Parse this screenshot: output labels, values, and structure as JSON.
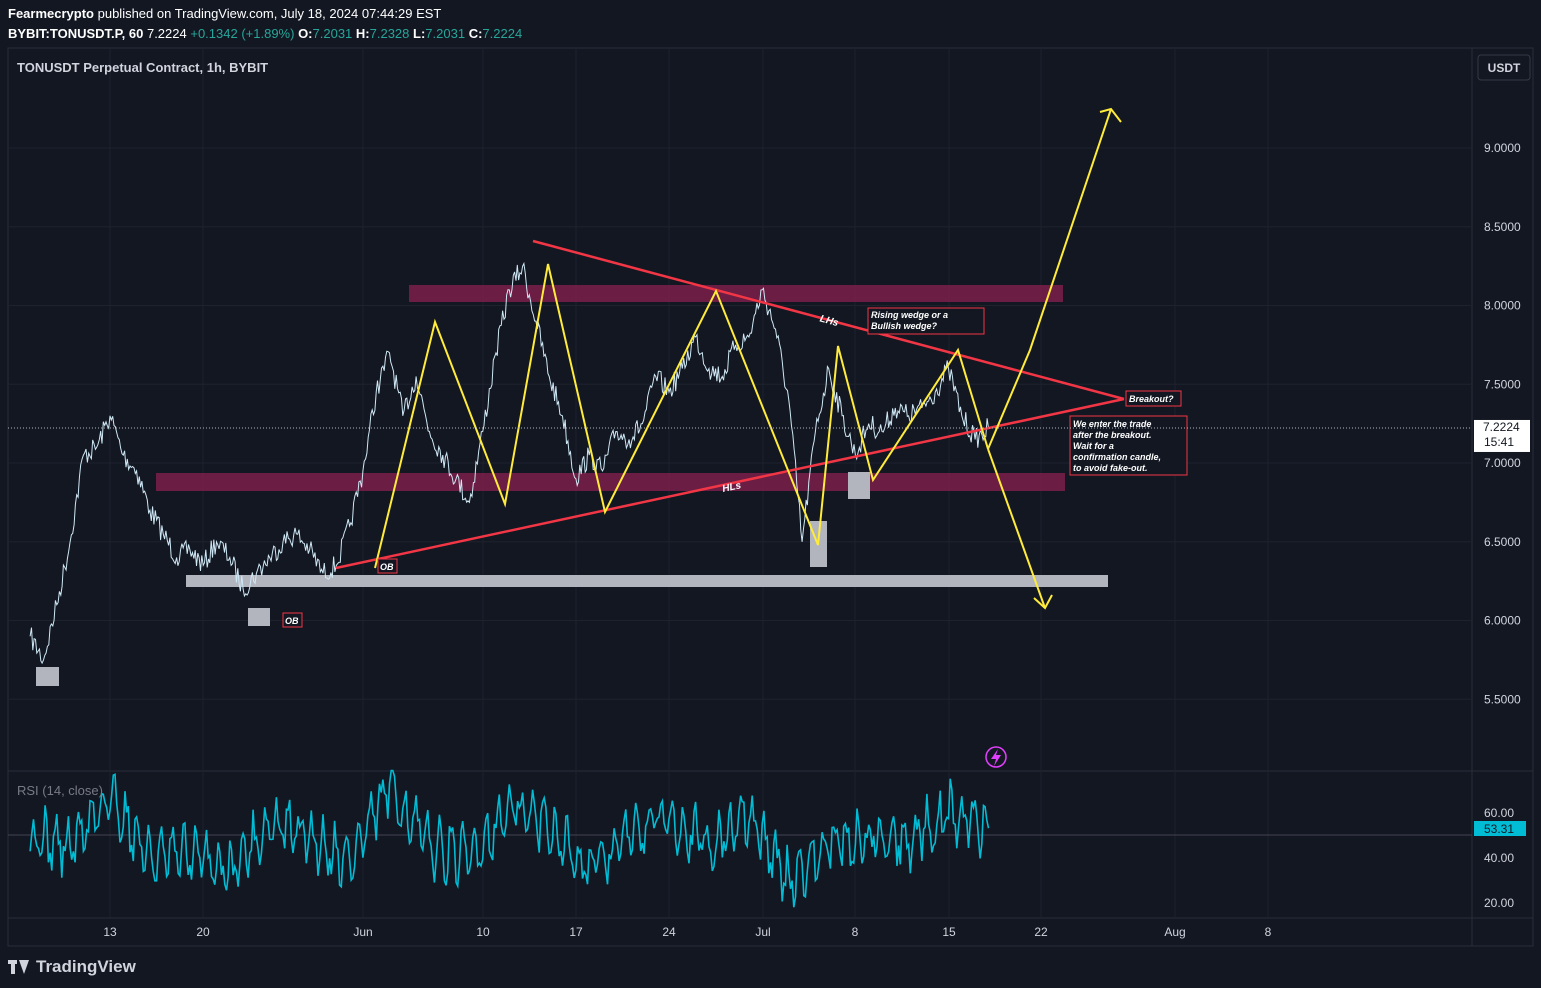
{
  "header": {
    "author": "Fearmecrypto",
    "published_text": "published on TradingView.com, July 18, 2024 07:44:29 EST",
    "symbol": "BYBIT:TONUSDT.P, 60",
    "last": "7.2224",
    "change": "+0.1342 (+1.89%)",
    "o_label": "O:",
    "o": "7.2031",
    "h_label": "H:",
    "h": "7.2328",
    "l_label": "L:",
    "l": "7.2031",
    "c_label": "C:",
    "c": "7.2224"
  },
  "pane_title": "TONUSDT Perpetual Contract, 1h, BYBIT",
  "currency": "USDT",
  "rsi_label": "RSI (14, close)",
  "footer": {
    "brand": "TradingView"
  },
  "colors": {
    "background": "#131722",
    "grid": "#1e222d",
    "price": "#cfe8f5",
    "rsi": "#00bcd4",
    "trendline": "#f23645",
    "zigzag": "#ffeb3b",
    "zone": "#7b1f4a",
    "ob_box": "#b2b5be",
    "current_badge": "#ffffff",
    "rsi_badge": "#00bcd4"
  },
  "chart_data": {
    "type": "line",
    "title": "TONUSDT Perpetual Contract, 1h, BYBIT",
    "x_tick_labels": [
      "13",
      "20",
      "Jun",
      "10",
      "17",
      "24",
      "Jul",
      "8",
      "15",
      "22",
      "Aug",
      "8"
    ],
    "y_tick_labels": [
      "9.0000",
      "8.5000",
      "8.0000",
      "7.5000",
      "7.0000",
      "6.5000",
      "6.0000",
      "5.5000"
    ],
    "ylim": [
      5.3,
      9.9
    ],
    "current_price": "7.2224",
    "countdown": "15:41",
    "price_path": {
      "x": [
        "2024-05-07",
        "2024-05-08",
        "2024-05-09",
        "2024-05-10",
        "2024-05-11",
        "2024-05-12",
        "2024-05-13",
        "2024-05-14",
        "2024-05-15",
        "2024-05-16",
        "2024-05-17",
        "2024-05-18",
        "2024-05-19",
        "2024-05-20",
        "2024-05-21",
        "2024-05-22",
        "2024-05-23",
        "2024-05-24",
        "2024-05-25",
        "2024-05-26",
        "2024-05-27",
        "2024-05-28",
        "2024-05-29",
        "2024-05-30",
        "2024-05-31",
        "2024-06-01",
        "2024-06-02",
        "2024-06-03",
        "2024-06-04",
        "2024-06-05",
        "2024-06-06",
        "2024-06-07",
        "2024-06-08",
        "2024-06-09",
        "2024-06-10",
        "2024-06-11",
        "2024-06-12",
        "2024-06-13",
        "2024-06-14",
        "2024-06-15",
        "2024-06-16",
        "2024-06-17",
        "2024-06-18",
        "2024-06-19",
        "2024-06-20",
        "2024-06-21",
        "2024-06-22",
        "2024-06-23",
        "2024-06-24",
        "2024-06-25",
        "2024-06-26",
        "2024-06-27",
        "2024-06-28",
        "2024-06-29",
        "2024-06-30",
        "2024-07-01",
        "2024-07-02",
        "2024-07-03",
        "2024-07-04",
        "2024-07-05",
        "2024-07-06",
        "2024-07-07",
        "2024-07-08",
        "2024-07-09",
        "2024-07-10",
        "2024-07-11",
        "2024-07-12",
        "2024-07-13",
        "2024-07-14",
        "2024-07-15",
        "2024-07-16",
        "2024-07-17",
        "2024-07-18"
      ],
      "y": [
        5.9,
        5.75,
        6.1,
        6.5,
        7.05,
        7.1,
        7.3,
        7.05,
        6.95,
        6.7,
        6.55,
        6.4,
        6.45,
        6.35,
        6.5,
        6.4,
        6.2,
        6.3,
        6.4,
        6.5,
        6.55,
        6.45,
        6.3,
        6.35,
        6.6,
        6.95,
        7.45,
        7.7,
        7.3,
        7.55,
        7.2,
        7.05,
        6.9,
        6.75,
        7.2,
        7.7,
        8.1,
        8.25,
        7.9,
        7.55,
        7.3,
        6.9,
        7.05,
        6.95,
        7.2,
        7.15,
        7.25,
        7.55,
        7.45,
        7.6,
        7.8,
        7.6,
        7.55,
        7.75,
        7.8,
        8.1,
        7.85,
        7.4,
        6.5,
        7.2,
        7.6,
        7.3,
        7.05,
        7.25,
        7.2,
        7.35,
        7.3,
        7.35,
        7.45,
        7.6,
        7.3,
        7.15,
        7.2224
      ]
    },
    "rsi": {
      "name": "RSI (14, close)",
      "ylim": [
        15,
        80
      ],
      "y_tick_labels": [
        "60.00",
        "40.00",
        "20.00"
      ],
      "last": "53.31",
      "x": [
        "2024-05-07",
        "2024-05-10",
        "2024-05-13",
        "2024-05-16",
        "2024-05-19",
        "2024-05-22",
        "2024-05-25",
        "2024-05-28",
        "2024-05-31",
        "2024-06-03",
        "2024-06-06",
        "2024-06-09",
        "2024-06-12",
        "2024-06-15",
        "2024-06-18",
        "2024-06-21",
        "2024-06-24",
        "2024-06-27",
        "2024-06-30",
        "2024-07-03",
        "2024-07-06",
        "2024-07-09",
        "2024-07-12",
        "2024-07-15",
        "2024-07-18"
      ],
      "y": [
        50,
        45,
        68,
        40,
        42,
        35,
        55,
        50,
        38,
        72,
        45,
        40,
        62,
        55,
        35,
        50,
        60,
        45,
        58,
        30,
        45,
        50,
        48,
        60,
        53.31
      ]
    },
    "annotations": [
      {
        "type": "text",
        "text": "Rising wedge or a Bullish wedge?"
      },
      {
        "type": "text",
        "text": "Breakout?"
      },
      {
        "type": "text",
        "text": "We enter the trade after the breakout. Wait for a confirmation candle, to avoid fake-out."
      },
      {
        "type": "text",
        "text": "LHs"
      },
      {
        "type": "text",
        "text": "HLs"
      },
      {
        "type": "text",
        "text": "OB"
      },
      {
        "type": "text",
        "text": "OB"
      }
    ]
  },
  "notes": {
    "wedge": "Rising wedge or a",
    "wedge2": "Bullish wedge?",
    "breakout": "Breakout?",
    "trade_lines": [
      "We enter the trade",
      "after the breakout.",
      "Wait for a",
      "confirmation candle,",
      "to avoid fake-out."
    ],
    "lhs": "LHs",
    "hls": "HLs",
    "ob1": "OB",
    "ob2": "OB"
  }
}
